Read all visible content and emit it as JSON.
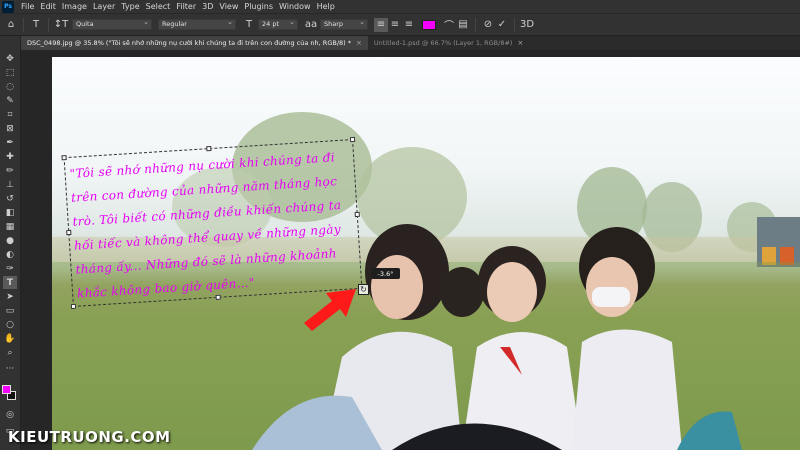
{
  "app": {
    "logo": "Ps"
  },
  "menu": [
    "File",
    "Edit",
    "Image",
    "Layer",
    "Type",
    "Select",
    "Filter",
    "3D",
    "View",
    "Plugins",
    "Window",
    "Help"
  ],
  "options": {
    "font_family": "Quita",
    "font_style": "Regular",
    "font_size": "24 pt",
    "anti_alias": "Sharp",
    "color": "#f500ff"
  },
  "tabs": [
    {
      "label": "DSC_0498.jpg @ 35.8% (\"Tôi sẽ nhớ những nụ cười khi chúng ta đi trên con đường của nh, RGB/8) *",
      "active": true
    },
    {
      "label": "Untitled-1.psd @ 66.7% (Layer 1, RGB/8#)",
      "active": false
    }
  ],
  "canvas": {
    "text_lines": [
      "\"Tôi sẽ nhớ những nụ cười khi chúng ta đi",
      "trên con đường của những năm tháng học",
      "trò. Tôi biết có những điều khiến chúng ta",
      "hối tiếc và không thể quay về những ngày",
      "tháng ấy... Những đó sẽ là những khoảnh",
      "khắc không bao giờ quên...\""
    ],
    "angle_readout": "-3.6°"
  },
  "watermark": "KIEUTRUONG.COM",
  "colors": {
    "foreground": "#f500ff",
    "background": "#111111",
    "accent_arrow": "#ff1a1a"
  }
}
